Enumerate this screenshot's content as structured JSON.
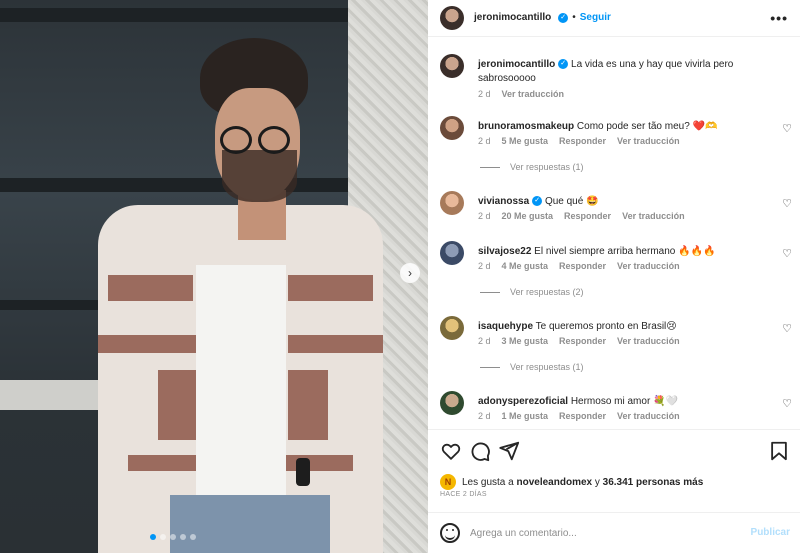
{
  "header": {
    "username": "jeronimocantillo",
    "follow_label": "Seguir",
    "more_label": "•••"
  },
  "caption": {
    "username": "jeronimocantillo",
    "text": "La vida es una y hay que vivirla pero sabrosooooo",
    "time": "2 d",
    "translate": "Ver traducción"
  },
  "comments": [
    {
      "username": "brunoramosmakeup",
      "verified": false,
      "text": "Como pode ser tão meu? ❤️🫶",
      "time": "2 d",
      "likes": "5 Me gusta",
      "reply": "Responder",
      "translate": "Ver traducción",
      "replies": "Ver respuestas (1)"
    },
    {
      "username": "vivianossa",
      "verified": true,
      "text": "Que qué 🤩",
      "time": "2 d",
      "likes": "20 Me gusta",
      "reply": "Responder",
      "translate": "Ver traducción",
      "replies": ""
    },
    {
      "username": "silvajose22",
      "verified": false,
      "text": "El nivel siempre arriba hermano 🔥🔥🔥",
      "time": "2 d",
      "likes": "4 Me gusta",
      "reply": "Responder",
      "translate": "Ver traducción",
      "replies": "Ver respuestas (2)"
    },
    {
      "username": "isaquehype",
      "verified": false,
      "text": "Te queremos pronto en Brasil😢",
      "time": "2 d",
      "likes": "3 Me gusta",
      "reply": "Responder",
      "translate": "Ver traducción",
      "replies": "Ver respuestas (1)"
    },
    {
      "username": "adonysperezoficial",
      "verified": false,
      "text": "Hermoso mi amor 💐🤍",
      "time": "2 d",
      "likes": "1 Me gusta",
      "reply": "Responder",
      "translate": "Ver traducción",
      "replies": ""
    }
  ],
  "likes": {
    "prefix": "Les gusta a",
    "user": "noveleandomex",
    "middle": "y",
    "count": "36.341 personas más",
    "avatar_letter": "N"
  },
  "posted": "HACE 2 DÍAS",
  "add_comment": {
    "placeholder": "Agrega un comentario...",
    "publish_label": "Publicar"
  },
  "colors": {
    "accent": "#0095f6",
    "publish_disabled": "#b2dffc",
    "muted": "#8e8e8e"
  },
  "carousel": {
    "current": 1,
    "total": 5
  }
}
